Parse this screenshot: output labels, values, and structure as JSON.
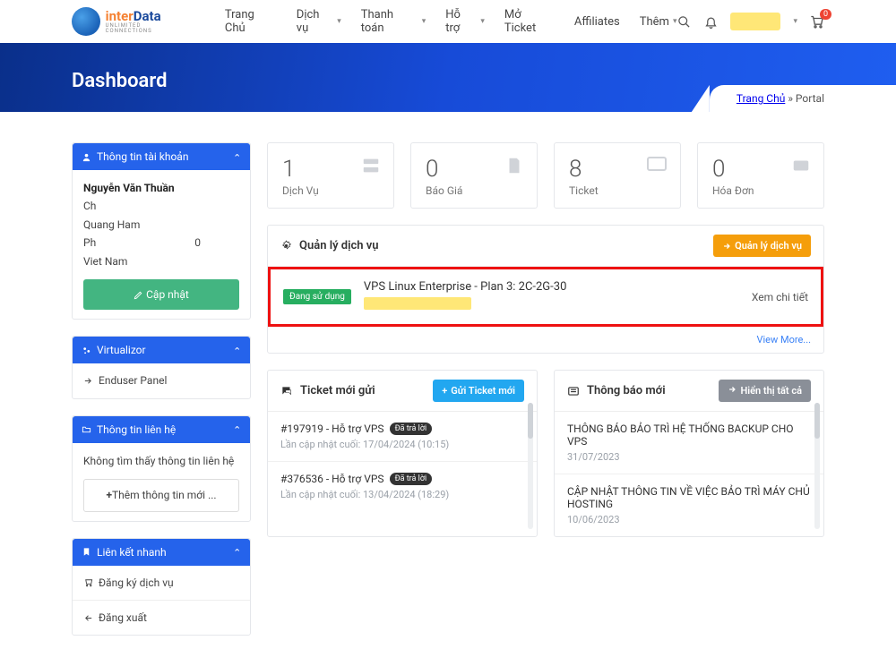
{
  "brand": {
    "name_a": "inter",
    "name_b": "Data",
    "tagline": "UNLIMITED CONNECTIONS"
  },
  "nav": {
    "home": "Trang Chủ",
    "services": "Dịch vụ",
    "billing": "Thanh toán",
    "support": "Hỗ trợ",
    "open_ticket": "Mở Ticket",
    "affiliates": "Affiliates",
    "more": "Thêm"
  },
  "cart": {
    "count": "0"
  },
  "hero": {
    "title": "Dashboard"
  },
  "breadcrumb": {
    "home": "Trang Chủ",
    "sep": "»",
    "current": "Portal"
  },
  "sidebar": {
    "account_hd": "Thông tin tài khoản",
    "name": "Nguyễn Văn Thuần",
    "line2": "Ch",
    "line3": "Quang Ham",
    "line4_a": "Ph",
    "line4_b": "0",
    "line5": "Viet Nam",
    "update_btn": "Cập nhật",
    "virt_hd": "Virtualizor",
    "virt_item": "Enduser Panel",
    "contact_hd": "Thông tin liên hệ",
    "contact_empty": "Không tìm thấy thông tin liên hệ",
    "contact_add": "Thêm thông tin mới ...",
    "links_hd": "Liên kết nhanh",
    "link_register": "Đăng ký dịch vụ",
    "link_logout": "Đăng xuất"
  },
  "stats": [
    {
      "num": "1",
      "label": "Dịch Vụ"
    },
    {
      "num": "0",
      "label": "Báo Giá"
    },
    {
      "num": "8",
      "label": "Ticket"
    },
    {
      "num": "0",
      "label": "Hóa Đơn"
    }
  ],
  "services": {
    "hd": "Quản lý dịch vụ",
    "manage_btn": "Quản lý dịch vụ",
    "status": "Đang sử dụng",
    "title": "VPS Linux Enterprise - Plan 3: 2C-2G-30",
    "detail_btn": "Xem chi tiết",
    "view_more": "View More..."
  },
  "tickets": {
    "hd": "Ticket mới gửi",
    "new_btn": "Gửi Ticket mới",
    "items": [
      {
        "title": "#197919 - Hỗ trợ VPS",
        "badge": "Đã trả lời",
        "meta": "Lần cập nhật cuối: 17/04/2024 (10:15)"
      },
      {
        "title": "#376536 - Hỗ trợ VPS",
        "badge": "Đã trả lời",
        "meta": "Lần cập nhật cuối: 13/04/2024 (18:29)"
      }
    ]
  },
  "news": {
    "hd": "Thông báo mới",
    "all_btn": "Hiển thị tất cả",
    "items": [
      {
        "title": "THÔNG BÁO BẢO TRÌ HỆ THỐNG BACKUP CHO VPS",
        "date": "31/07/2023"
      },
      {
        "title": "CẬP NHẬT THÔNG TIN VỀ VIỆC BẢO TRÌ MÁY CHỦ HOSTING",
        "date": "10/06/2023"
      }
    ]
  },
  "icons": {
    "plus": "+",
    "chev_raquo": "»"
  }
}
